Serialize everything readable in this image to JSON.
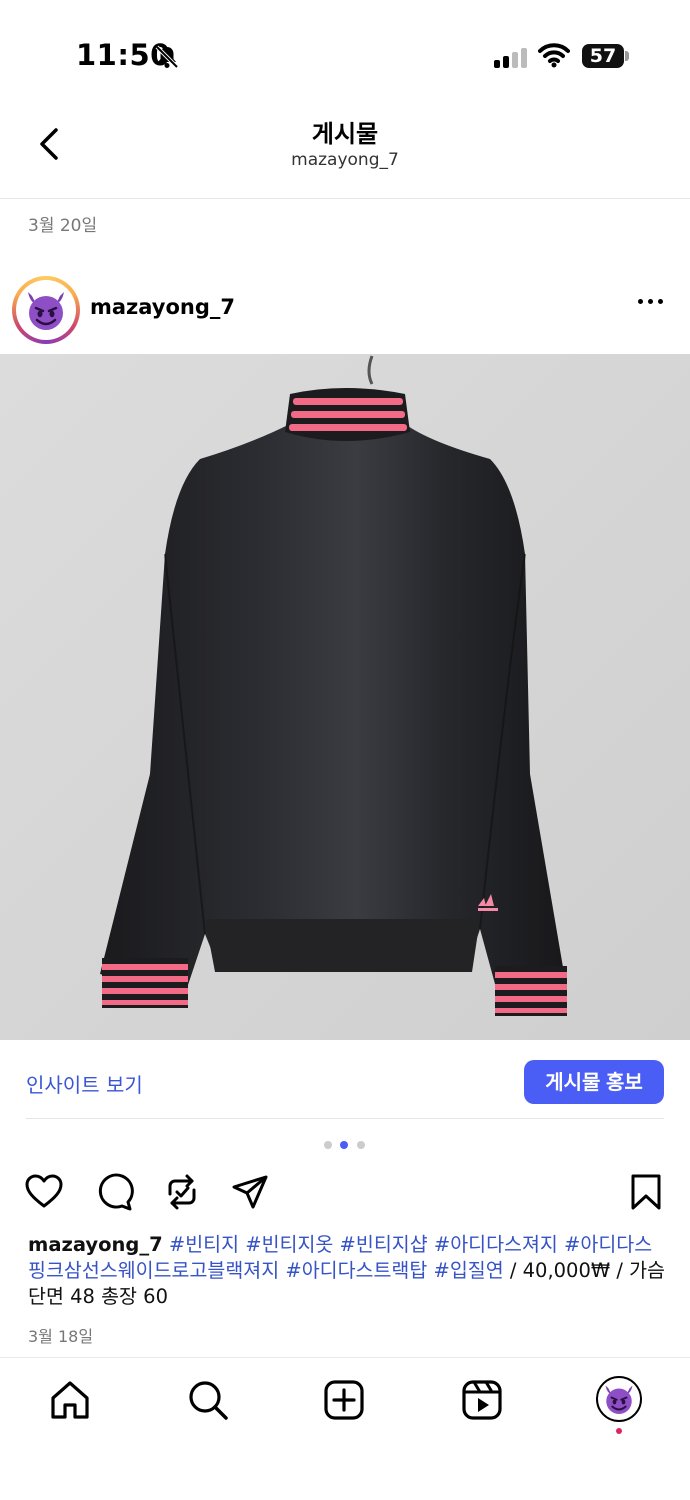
{
  "status_bar": {
    "time": "11:50",
    "battery": "57"
  },
  "header": {
    "title": "게시물",
    "subtitle": "mazayong_7"
  },
  "post_date_header": "3월 20일",
  "post": {
    "username": "mazayong_7",
    "avatar_emoji": "😈",
    "insights_label": "인사이트 보기",
    "promote_label": "게시물 홍보",
    "carousel": {
      "count": 3,
      "active_index": 1
    },
    "caption": {
      "username": "mazayong_7",
      "hashtags": [
        "#빈티지",
        "#빈티지옷",
        "#빈티지샵",
        "#아디다스져지",
        "#아디다스핑크삼선스웨이드로고블랙져지",
        "#아디다스트랙탑",
        "#입질연"
      ],
      "text": " / 40,000₩ / 가슴단면 48 총장 60"
    },
    "date": "3월 18일"
  },
  "icons": {
    "back": "back-arrow-icon",
    "more": "more-options-icon",
    "like": "heart-icon",
    "comment": "comment-icon",
    "repost": "repost-icon",
    "share": "send-icon",
    "save": "bookmark-icon",
    "nav": [
      "home-icon",
      "search-icon",
      "create-icon",
      "reels-icon",
      "profile-icon"
    ]
  },
  "colors": {
    "link": "#3a56d6",
    "promote_button": "#4a5df5",
    "hashtag": "#3653c7",
    "jacket": "#1f1f22",
    "stripe": "#f36a86"
  }
}
